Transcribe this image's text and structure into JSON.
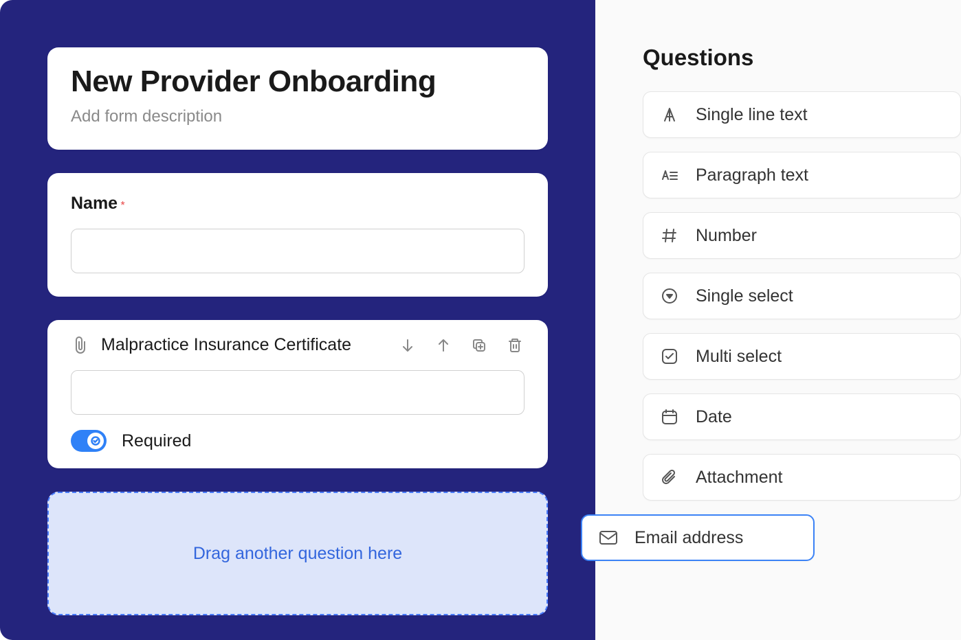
{
  "form": {
    "title": "New Provider Onboarding",
    "description_placeholder": "Add form description"
  },
  "fields": {
    "name": {
      "label": "Name",
      "required": true
    },
    "malpractice": {
      "title": "Malpractice Insurance Certificate",
      "required_label": "Required"
    }
  },
  "drop_zone": {
    "text": "Drag another question here"
  },
  "sidebar": {
    "title": "Questions",
    "types": [
      {
        "label": "Single line text"
      },
      {
        "label": "Paragraph text"
      },
      {
        "label": "Number"
      },
      {
        "label": "Single select"
      },
      {
        "label": "Multi select"
      },
      {
        "label": "Date"
      },
      {
        "label": "Attachment"
      },
      {
        "label": "Email address"
      }
    ]
  }
}
